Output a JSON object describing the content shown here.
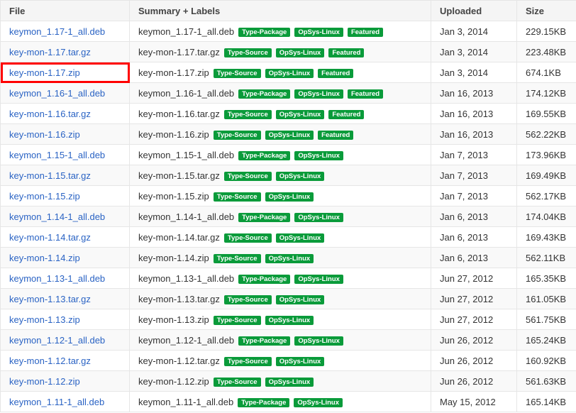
{
  "headers": {
    "file": "File",
    "summary": "Summary + Labels",
    "uploaded": "Uploaded",
    "size": "Size"
  },
  "colors": {
    "label_bg": "#0a9b3a",
    "link": "#2a63c4",
    "selection": "#ff0000"
  },
  "selected_row": 2,
  "rows": [
    {
      "file": "keymon_1.17-1_all.deb",
      "summary": "keymon_1.17-1_all.deb",
      "labels": [
        "Type-Package",
        "OpSys-Linux",
        "Featured"
      ],
      "uploaded": "Jan 3, 2014",
      "size": "229.15KB"
    },
    {
      "file": "key-mon-1.17.tar.gz",
      "summary": "key-mon-1.17.tar.gz",
      "labels": [
        "Type-Source",
        "OpSys-Linux",
        "Featured"
      ],
      "uploaded": "Jan 3, 2014",
      "size": "223.48KB"
    },
    {
      "file": "key-mon-1.17.zip",
      "summary": "key-mon-1.17.zip",
      "labels": [
        "Type-Source",
        "OpSys-Linux",
        "Featured"
      ],
      "uploaded": "Jan 3, 2014",
      "size": "674.1KB"
    },
    {
      "file": "keymon_1.16-1_all.deb",
      "summary": "keymon_1.16-1_all.deb",
      "labels": [
        "Type-Package",
        "OpSys-Linux",
        "Featured"
      ],
      "uploaded": "Jan 16, 2013",
      "size": "174.12KB"
    },
    {
      "file": "key-mon-1.16.tar.gz",
      "summary": "key-mon-1.16.tar.gz",
      "labels": [
        "Type-Source",
        "OpSys-Linux",
        "Featured"
      ],
      "uploaded": "Jan 16, 2013",
      "size": "169.55KB"
    },
    {
      "file": "key-mon-1.16.zip",
      "summary": "key-mon-1.16.zip",
      "labels": [
        "Type-Source",
        "OpSys-Linux",
        "Featured"
      ],
      "uploaded": "Jan 16, 2013",
      "size": "562.22KB"
    },
    {
      "file": "keymon_1.15-1_all.deb",
      "summary": "keymon_1.15-1_all.deb",
      "labels": [
        "Type-Package",
        "OpSys-Linux"
      ],
      "uploaded": "Jan 7, 2013",
      "size": "173.96KB"
    },
    {
      "file": "key-mon-1.15.tar.gz",
      "summary": "key-mon-1.15.tar.gz",
      "labels": [
        "Type-Source",
        "OpSys-Linux"
      ],
      "uploaded": "Jan 7, 2013",
      "size": "169.49KB"
    },
    {
      "file": "key-mon-1.15.zip",
      "summary": "key-mon-1.15.zip",
      "labels": [
        "Type-Source",
        "OpSys-Linux"
      ],
      "uploaded": "Jan 7, 2013",
      "size": "562.17KB"
    },
    {
      "file": "keymon_1.14-1_all.deb",
      "summary": "keymon_1.14-1_all.deb",
      "labels": [
        "Type-Package",
        "OpSys-Linux"
      ],
      "uploaded": "Jan 6, 2013",
      "size": "174.04KB"
    },
    {
      "file": "key-mon-1.14.tar.gz",
      "summary": "key-mon-1.14.tar.gz",
      "labels": [
        "Type-Source",
        "OpSys-Linux"
      ],
      "uploaded": "Jan 6, 2013",
      "size": "169.43KB"
    },
    {
      "file": "key-mon-1.14.zip",
      "summary": "key-mon-1.14.zip",
      "labels": [
        "Type-Source",
        "OpSys-Linux"
      ],
      "uploaded": "Jan 6, 2013",
      "size": "562.11KB"
    },
    {
      "file": "keymon_1.13-1_all.deb",
      "summary": "keymon_1.13-1_all.deb",
      "labels": [
        "Type-Package",
        "OpSys-Linux"
      ],
      "uploaded": "Jun 27, 2012",
      "size": "165.35KB"
    },
    {
      "file": "key-mon-1.13.tar.gz",
      "summary": "key-mon-1.13.tar.gz",
      "labels": [
        "Type-Source",
        "OpSys-Linux"
      ],
      "uploaded": "Jun 27, 2012",
      "size": "161.05KB"
    },
    {
      "file": "key-mon-1.13.zip",
      "summary": "key-mon-1.13.zip",
      "labels": [
        "Type-Source",
        "OpSys-Linux"
      ],
      "uploaded": "Jun 27, 2012",
      "size": "561.75KB"
    },
    {
      "file": "keymon_1.12-1_all.deb",
      "summary": "keymon_1.12-1_all.deb",
      "labels": [
        "Type-Package",
        "OpSys-Linux"
      ],
      "uploaded": "Jun 26, 2012",
      "size": "165.24KB"
    },
    {
      "file": "key-mon-1.12.tar.gz",
      "summary": "key-mon-1.12.tar.gz",
      "labels": [
        "Type-Source",
        "OpSys-Linux"
      ],
      "uploaded": "Jun 26, 2012",
      "size": "160.92KB"
    },
    {
      "file": "key-mon-1.12.zip",
      "summary": "key-mon-1.12.zip",
      "labels": [
        "Type-Source",
        "OpSys-Linux"
      ],
      "uploaded": "Jun 26, 2012",
      "size": "561.63KB"
    },
    {
      "file": "keymon_1.11-1_all.deb",
      "summary": "keymon_1.11-1_all.deb",
      "labels": [
        "Type-Package",
        "OpSys-Linux"
      ],
      "uploaded": "May 15, 2012",
      "size": "165.14KB"
    }
  ]
}
